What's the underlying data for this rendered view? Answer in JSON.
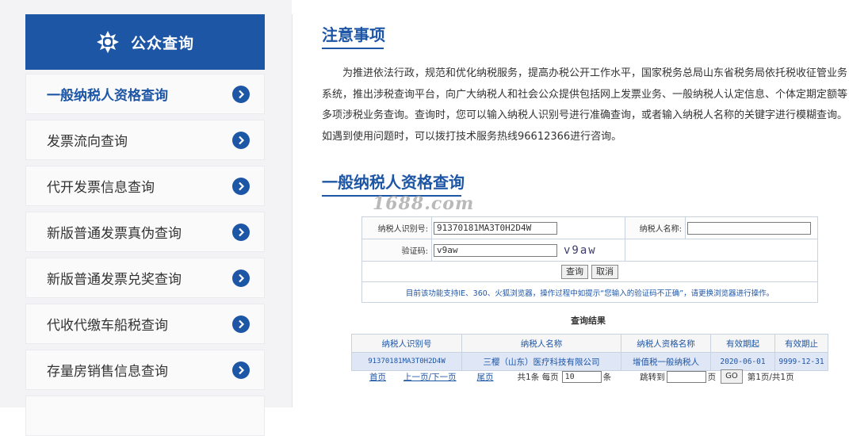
{
  "sidebar": {
    "title": "公众查询",
    "items": [
      {
        "label": "一般纳税人资格查询"
      },
      {
        "label": "发票流向查询"
      },
      {
        "label": "代开发票信息查询"
      },
      {
        "label": "新版普通发票真伪查询"
      },
      {
        "label": "新版普通发票兑奖查询"
      },
      {
        "label": "代收代缴车船税查询"
      },
      {
        "label": "存量房销售信息查询"
      }
    ]
  },
  "main": {
    "notice_title": "注意事项",
    "notice_text": "为推进依法行政，规范和优化纳税服务，提高办税公开工作水平，国家税务总局山东省税务局依托税收征管业务系统，推出涉税查询平台，向广大纳税人和社会公众提供包括网上发票业务、一般纳税人认定信息、个体定期定额等多项涉税业务查询。查询时，您可以输入纳税人识别号进行准确查询，或者输入纳税人名称的关键字进行模糊查询。如遇到使用问题时，可以拨打技术服务热线96612366进行咨询。",
    "query_title": "一般纳税人资格查询",
    "watermark": "1688.com"
  },
  "form": {
    "id_label": "纳税人识别号:",
    "id_value": "91370181MA3T0H2D4W",
    "name_label": "纳税人名称:",
    "name_value": "",
    "captcha_label": "验证码:",
    "captcha_value": "v9aw",
    "captcha_image_text": "v9aw",
    "query_button": "查询",
    "cancel_button": "取消",
    "browser_notice": "目前该功能支持IE、360、火狐浏览器，操作过程中如提示“您输入的验证码不正确”，请更换浏览器进行操作。"
  },
  "results": {
    "title": "查询结果",
    "columns": [
      "纳税人识别号",
      "纳税人名称",
      "纳税人资格名称",
      "有效期起",
      "有效期止"
    ],
    "rows": [
      [
        "91370181MA3T0H2D4W",
        "三樱（山东）医疗科技有限公司",
        "增值税一般纳税人",
        "2020-06-01",
        "9999-12-31"
      ]
    ]
  },
  "pager": {
    "first": "首页",
    "prev_next": "上一页/下一页",
    "last": "尾页",
    "total": "共1条 每页",
    "per_page": "10",
    "per_unit": "条",
    "jump_label": "跳转到",
    "jump_value": "",
    "page_unit": "页",
    "go_button": "GO",
    "page_info": "第1页/共1页"
  },
  "colors": {
    "brand": "#1e56a6",
    "sidebar_bg": "#f3f3f5",
    "row_highlight": "#dfe6f5"
  }
}
